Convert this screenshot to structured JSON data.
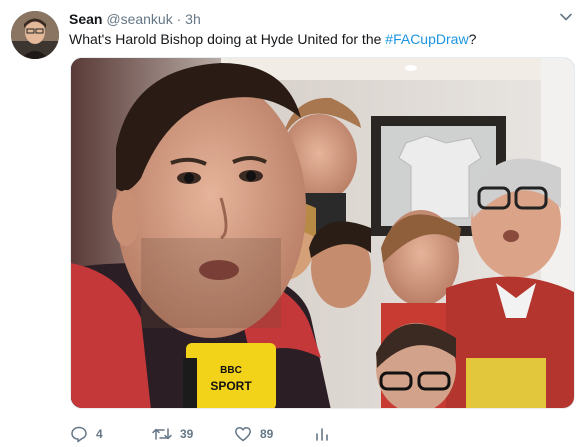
{
  "tweet": {
    "author_name": "Sean",
    "handle": "@seankuk",
    "separator": "·",
    "time": "3h",
    "text_prefix": "What's Harold Bishop doing at Hyde United for the ",
    "hashtag": "#FACupDraw",
    "text_suffix": "?"
  },
  "media": {
    "mic_brand_top": "BBC",
    "mic_brand_bottom": "SPORT"
  },
  "actions": {
    "reply_count": "4",
    "retweet_count": "39",
    "like_count": "89"
  },
  "colors": {
    "link": "#1b95e0",
    "muted": "#657786",
    "text": "#14171a"
  }
}
